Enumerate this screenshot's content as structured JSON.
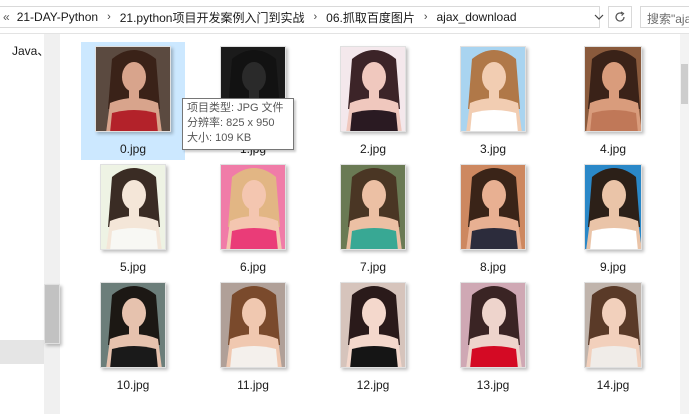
{
  "address": {
    "lead": "«",
    "segments": [
      "21-DAY-Python",
      "21.python项目开发案例入门到实战",
      "06.抓取百度图片",
      "ajax_download"
    ],
    "separator": "›",
    "dropdown_icon": "chevron-down-icon",
    "refresh_icon": "refresh-icon"
  },
  "search": {
    "placeholder": "搜索\"ajax_download\"",
    "display": "搜索\"aja"
  },
  "nav": {
    "visible_item": "Java、"
  },
  "files": [
    {
      "name": "0.jpg",
      "skin": "#d8a48c",
      "hair": "#3a2218",
      "bg": "#5b4a40",
      "cloth": "#b3222a"
    },
    {
      "name": "1.jpg",
      "skin": "#2a2a2a",
      "hair": "#121212",
      "bg": "#1b1b1b",
      "cloth": "#303030"
    },
    {
      "name": "2.jpg",
      "skin": "#f0c8be",
      "hair": "#3c2428",
      "bg": "#f4e8ec",
      "cloth": "#2a1a22"
    },
    {
      "name": "3.jpg",
      "skin": "#f2cdb2",
      "hair": "#b07848",
      "bg": "#a9d4f0",
      "cloth": "#ffffff"
    },
    {
      "name": "4.jpg",
      "skin": "#d99c7c",
      "hair": "#3a2218",
      "bg": "#8a5a3c",
      "cloth": "#c07858"
    },
    {
      "name": "5.jpg",
      "skin": "#f4e6d8",
      "hair": "#3a2c24",
      "bg": "#eef3e4",
      "cloth": "#f8f8f4"
    },
    {
      "name": "6.jpg",
      "skin": "#f4c6b0",
      "hair": "#e2b684",
      "bg": "#f07ca8",
      "cloth": "#ea3c78"
    },
    {
      "name": "7.jpg",
      "skin": "#ecc0a4",
      "hair": "#4a3624",
      "bg": "#6a7a54",
      "cloth": "#38a894"
    },
    {
      "name": "8.jpg",
      "skin": "#e8b092",
      "hair": "#3a2418",
      "bg": "#cd8860",
      "cloth": "#2c2c3c"
    },
    {
      "name": "9.jpg",
      "skin": "#eac4a8",
      "hair": "#2c2018",
      "bg": "#2a88c8",
      "cloth": "#ffffff"
    },
    {
      "name": "10.jpg",
      "skin": "#e6c2ae",
      "hair": "#1c1814",
      "bg": "#6c7e7a",
      "cloth": "#1a1a1a"
    },
    {
      "name": "11.jpg",
      "skin": "#f0c8b0",
      "hair": "#7a4a2c",
      "bg": "#b0a098",
      "cloth": "#f4f0ec"
    },
    {
      "name": "12.jpg",
      "skin": "#f4d8cc",
      "hair": "#2a1a1a",
      "bg": "#d6c4bc",
      "cloth": "#151515"
    },
    {
      "name": "13.jpg",
      "skin": "#eed4cc",
      "hair": "#3a2424",
      "bg": "#cfa8b4",
      "cloth": "#d40a24"
    },
    {
      "name": "14.jpg",
      "skin": "#f2d0bc",
      "hair": "#5a3a28",
      "bg": "#c0b4ac",
      "cloth": "#f0ece8"
    }
  ],
  "tooltip": {
    "type": "项目类型: JPG 文件",
    "resolution": "分辨率: 825 x 950",
    "size": "大小: 109 KB"
  }
}
